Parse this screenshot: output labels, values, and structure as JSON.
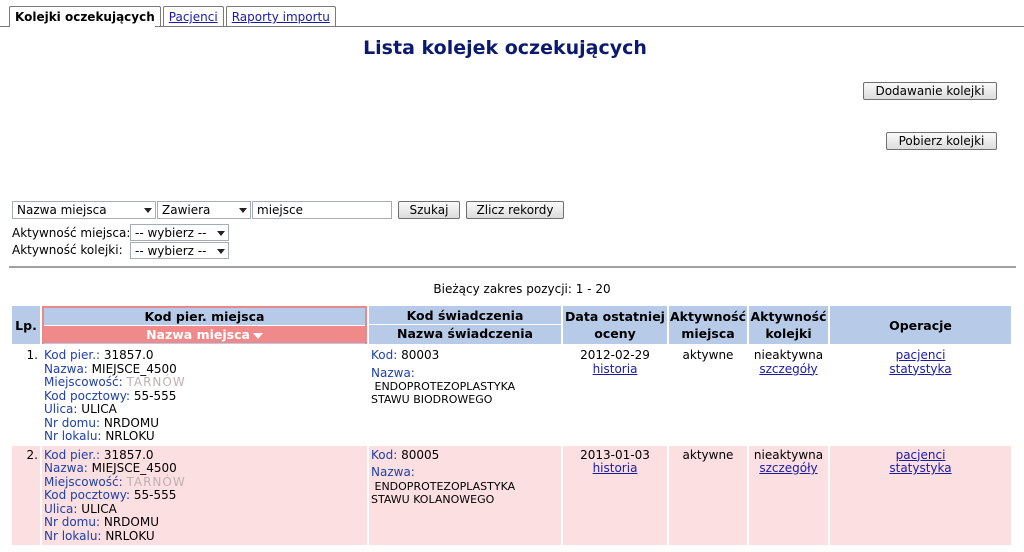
{
  "tabs": [
    {
      "label": "Kolejki oczekujących",
      "active": true
    },
    {
      "label": "Pacjenci",
      "active": false
    },
    {
      "label": "Raporty importu",
      "active": false
    }
  ],
  "page": {
    "title": "Lista kolejek oczekujących"
  },
  "buttons": {
    "add_queue": "Dodawanie kolejki",
    "fetch_queue": "Pobierz kolejki",
    "search": "Szukaj",
    "count": "Zlicz rekordy"
  },
  "search": {
    "field_value": "Nazwa miejsca",
    "operator_value": "Zawiera",
    "query_value": "miejsce"
  },
  "filters": {
    "place_activity_label": "Aktywność miejsca:",
    "place_activity_value": "-- wybierz --",
    "queue_activity_label": "Aktywność kolejki:",
    "queue_activity_value": "-- wybierz --"
  },
  "range_text": "Bieżący zakres pozycji: 1 - 20",
  "table": {
    "headers": {
      "lp": "Lp.",
      "place_code": "Kod pier. miejsca",
      "place_name": "Nazwa miejsca",
      "service_code": "Kod świadczenia",
      "service_name": "Nazwa świadczenia",
      "last_eval_line1": "Data ostatniej",
      "last_eval_line2": "oceny",
      "place_activity_line1": "Aktywność",
      "place_activity_line2": "miejsca",
      "queue_activity_line1": "Aktywność",
      "queue_activity_line2": "kolejki",
      "operations": "Operacje"
    },
    "field_labels": {
      "code": "Kod pier.:",
      "name": "Nazwa:",
      "city": "Miejscowość:",
      "postal": "Kod pocztowy:",
      "street": "Ulica:",
      "house": "Nr domu:",
      "flat": "Nr lokalu:",
      "service_code": "Kod:",
      "service_name": "Nazwa:"
    },
    "links": {
      "history": "historia",
      "details": "szczegóły",
      "patients": "pacjenci",
      "stats": "statystyka"
    },
    "rows": [
      {
        "lp": "1.",
        "code": "31857.0",
        "name": "MIEJSCE_4500",
        "city": "TARNÓW",
        "postal": "55-555",
        "street": "ULICA",
        "house": "NRDOMU",
        "flat": "NRLOKU",
        "service_code": "80003",
        "service_name_1": "ENDOPROTEZOPLASTYKA",
        "service_name_2": "STAWU BIODROWEGO",
        "last_eval": "2012-02-29",
        "place_activity": "aktywne",
        "queue_activity": "nieaktywna"
      },
      {
        "lp": "2.",
        "code": "31857.0",
        "name": "MIEJSCE_4500",
        "city": "TARNÓW",
        "postal": "55-555",
        "street": "ULICA",
        "house": "NRDOMU",
        "flat": "NRLOKU",
        "service_code": "80005",
        "service_name_1": "ENDOPROTEZOPLASTYKA",
        "service_name_2": "STAWU KOLANOWEGO",
        "last_eval": "2013-01-03",
        "place_activity": "aktywne",
        "queue_activity": "nieaktywna"
      }
    ]
  }
}
